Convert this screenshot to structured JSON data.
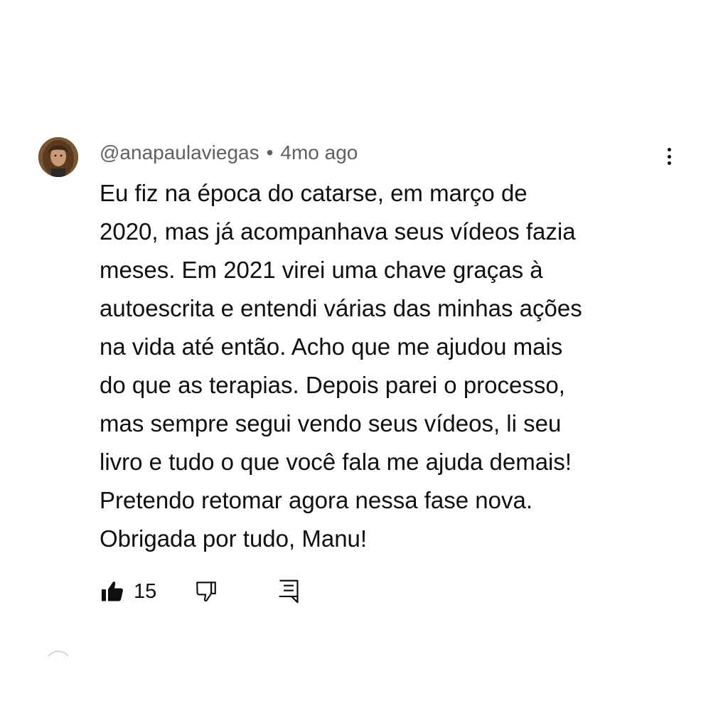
{
  "comment": {
    "author": "@anapaulaviegas",
    "separator": "•",
    "timestamp": "4mo ago",
    "avatar_icon": "user-avatar-photo",
    "more_icon": "more-vert-icon",
    "text_lines": [
      "Eu fiz na época do catarse, em março de",
      "2020, mas já acompanhava seus vídeos fazia",
      "meses. Em 2021 virei uma chave graças à",
      "autoescrita e entendi várias das minhas ações",
      "na vida até então. Acho que me ajudou mais",
      "do que as terapias. Depois parei o processo,",
      "mas sempre segui vendo seus vídeos, li seu",
      "livro e tudo o que você fala me ajuda demais!",
      "Pretendo retomar agora nessa fase nova.",
      "Obrigada por tudo, Manu!"
    ],
    "actions": {
      "like_icon": "thumbs-up-filled-icon",
      "like_count": "15",
      "dislike_icon": "thumbs-down-outline-icon",
      "reply_icon": "reply-comment-icon"
    }
  },
  "colors": {
    "text": "#0f0f0f",
    "meta": "#606060",
    "background": "#ffffff"
  }
}
